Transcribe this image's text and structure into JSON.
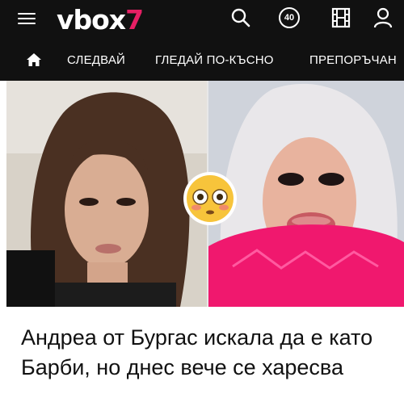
{
  "header": {
    "logo_main": "vbox",
    "logo_accent": "7",
    "notification_count": "40",
    "icons": [
      "menu-icon",
      "search-icon",
      "badge-icon",
      "film-icon",
      "user-icon"
    ],
    "accent_color": "#e61f64",
    "background_color": "#111111"
  },
  "nav": {
    "home_icon": "home-icon",
    "items": [
      {
        "label": "СЛЕДВАЙ"
      },
      {
        "label": "ГЛЕДАЙ ПО-КЪСНО"
      },
      {
        "label": "ПРЕПОРЪЧАН"
      }
    ]
  },
  "article": {
    "emoji": "flushed-face-emoji",
    "headline": "Андреа от Бургас искала да е като Барби, но днес вече се харесва"
  }
}
